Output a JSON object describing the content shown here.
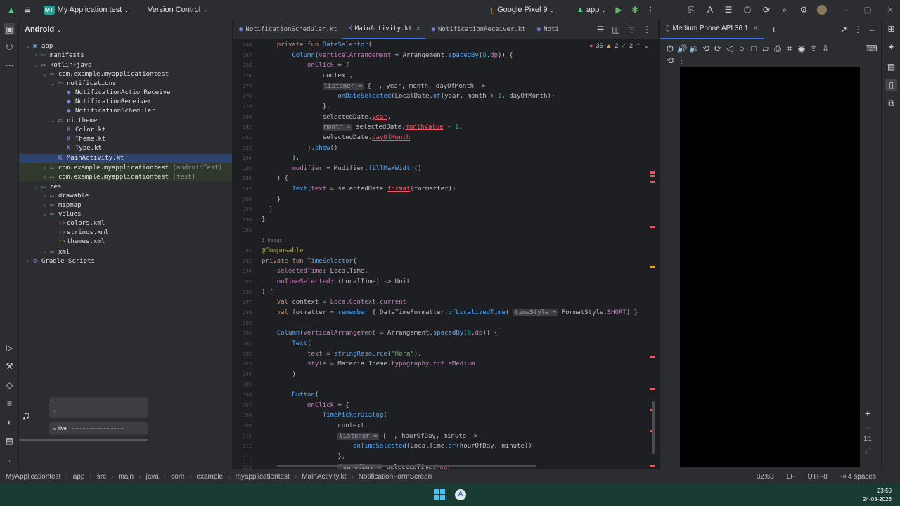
{
  "titlebar": {
    "logo": "MT",
    "project": "My Application test",
    "vcs": "Version Control",
    "device": "Google Pixel 9",
    "run_config": "app"
  },
  "project_panel": {
    "view": "Android",
    "tree": [
      {
        "label": "app",
        "depth": 0,
        "type": "module",
        "open": true
      },
      {
        "label": "manifests",
        "depth": 1,
        "type": "folder",
        "open": false
      },
      {
        "label": "kotlin+java",
        "depth": 1,
        "type": "folder",
        "open": true
      },
      {
        "label": "com.example.myapplicationtest",
        "depth": 2,
        "type": "package",
        "open": true
      },
      {
        "label": "notifications",
        "depth": 3,
        "type": "package",
        "open": true
      },
      {
        "label": "NotificationActionReceiver",
        "depth": 4,
        "type": "class"
      },
      {
        "label": "NotificationReceiver",
        "depth": 4,
        "type": "class"
      },
      {
        "label": "NotificationScheduler",
        "depth": 4,
        "type": "class"
      },
      {
        "label": "ui.theme",
        "depth": 3,
        "type": "package",
        "open": true
      },
      {
        "label": "Color.kt",
        "depth": 4,
        "type": "kt"
      },
      {
        "label": "Theme.kt",
        "depth": 4,
        "type": "kt"
      },
      {
        "label": "Type.kt",
        "depth": 4,
        "type": "kt"
      },
      {
        "label": "MainActivity.kt",
        "depth": 3,
        "type": "kt",
        "selected": true
      },
      {
        "label": "com.example.myapplicationtest (androidTest)",
        "depth": 2,
        "type": "package",
        "open": false
      },
      {
        "label": "com.example.myapplicationtest (test)",
        "depth": 2,
        "type": "package",
        "open": false
      },
      {
        "label": "res",
        "depth": 1,
        "type": "folder",
        "open": true
      },
      {
        "label": "drawable",
        "depth": 2,
        "type": "folder",
        "open": false
      },
      {
        "label": "mipmap",
        "depth": 2,
        "type": "folder",
        "open": false
      },
      {
        "label": "values",
        "depth": 2,
        "type": "folder",
        "open": true
      },
      {
        "label": "colors.xml",
        "depth": 3,
        "type": "xml"
      },
      {
        "label": "strings.xml",
        "depth": 3,
        "type": "xml"
      },
      {
        "label": "themes.xml",
        "depth": 3,
        "type": "xml"
      },
      {
        "label": "xml",
        "depth": 2,
        "type": "folder",
        "open": false
      },
      {
        "label": "Gradle Scripts",
        "depth": 0,
        "type": "gradle",
        "open": false
      }
    ]
  },
  "editor": {
    "tabs": [
      {
        "label": "NotificationScheduler.kt",
        "active": false
      },
      {
        "label": "MainActivity.kt",
        "active": true
      },
      {
        "label": "NotificationReceiver.kt",
        "active": false
      },
      {
        "label": "Noti",
        "active": false
      }
    ],
    "inspections": {
      "errors": "35",
      "warnings": "2",
      "weak": "2"
    },
    "lines": [
      {
        "n": "268",
        "h": "    <span class=kw>private fun</span> <span class=fn>DateSelector</span>("
      },
      {
        "n": "267",
        "h": "        <span class=fn>Column</span>(<span class=ty>verticalArrangement</span> = Arrangement.<span class=fn>spacedBy</span>(<span class=num>8</span>.<span class=ty>dp</span>)) {"
      },
      {
        "n": "268",
        "h": "            <span class=ty>onClick</span> = {"
      },
      {
        "n": "276",
        "h": "                context,"
      },
      {
        "n": "277",
        "h": "                <span class=hint>listener =</span> { _, year, month, dayOfMonth -&gt;"
      },
      {
        "n": "278",
        "h": "                    <span class=fn>onDateSelected</span>(LocalDate.<span class=fn>of</span>(year, month + <span class=num>1</span>, dayOfMonth))"
      },
      {
        "n": "279",
        "h": "                },"
      },
      {
        "n": "280",
        "h": "                selectedDate.<span class=err>year</span>,"
      },
      {
        "n": "281",
        "h": "                <span class=hint>month =</span> selectedDate.<span class=err>monthValue</span> - <span class=num>1</span>,"
      },
      {
        "n": "282",
        "h": "                selectedDate.<span class=err>dayOfMonth</span>"
      },
      {
        "n": "283",
        "h": "            ).<span class=fn>show</span>()"
      },
      {
        "n": "284",
        "h": "        },"
      },
      {
        "n": "285",
        "h": "        <span class=ty>modifier</span> = Modifier.<span class=fn>fillMaxWidth</span>()"
      },
      {
        "n": "286",
        "h": "    ) {"
      },
      {
        "n": "287",
        "h": "        <span class=fn>Text</span>(<span class=ty>text</span> = selectedDate.<span class=err>format</span>(formatter))"
      },
      {
        "n": "288",
        "h": "    }"
      },
      {
        "n": "289",
        "h": "  }"
      },
      {
        "n": "290",
        "h": "}"
      },
      {
        "n": "291",
        "h": ""
      },
      {
        "n": "",
        "h": "<span style='color:#6f737a;font-size:7px'>1 Usage</span>"
      },
      {
        "n": "292",
        "h": "<span class=ann>@Composable</span>"
      },
      {
        "n": "293",
        "h": "<span class=kw>private fun</span> <span class=fn>TimeSelector</span>("
      },
      {
        "n": "294",
        "h": "    <span class=ty>selectedTime</span>: LocalTime,"
      },
      {
        "n": "295",
        "h": "    <span class=ty>onTimeSelected</span>: (LocalTime) -&gt; Unit"
      },
      {
        "n": "296",
        "h": ") {"
      },
      {
        "n": "297",
        "h": "    <span class=kw>val</span> context = <span class=ty>LocalContext</span>.<span class=ty>current</span>"
      },
      {
        "n": "298",
        "h": "    <span class=kw>val</span> formatter = <span class=fn>remember</span> { DateTimeFormatter.<span class=fn>ofLocalizedTime</span>( <span class=hint>timeStyle =</span> FormatStyle.<span class=ty>SHORT</span>) }"
      },
      {
        "n": "299",
        "h": ""
      },
      {
        "n": "300",
        "h": "    <span class=fn>Column</span>(<span class=ty>verticalArrangement</span> = Arrangement.<span class=fn>spacedBy</span>(<span class=num>8</span>.<span class=ty>dp</span>)) {"
      },
      {
        "n": "301",
        "h": "        <span class=fn>Text</span>("
      },
      {
        "n": "302",
        "h": "            <span class=ty>text</span> = <span class=fn>stringResource</span>(<span class=str>\"Hora\"</span>),"
      },
      {
        "n": "303",
        "h": "            <span class=ty>style</span> = MaterialTheme.<span class=ty>typography</span>.<span class=ty>titleMedium</span>"
      },
      {
        "n": "304",
        "h": "        )"
      },
      {
        "n": "305",
        "h": ""
      },
      {
        "n": "306",
        "h": "        <span class=fn>Button</span>("
      },
      {
        "n": "307",
        "h": "            <span class=ty>onClick</span> = {"
      },
      {
        "n": "308",
        "h": "                <span class=fn>TimePickerDialog</span>("
      },
      {
        "n": "309",
        "h": "                    context,"
      },
      {
        "n": "310",
        "h": "                    <span class=hint>listener =</span> { _, hourOfDay, minute -&gt;"
      },
      {
        "n": "311",
        "h": "                        <span class=fn>onTimeSelected</span>(LocalTime.<span class=fn>of</span>(hourOfDay, minute))"
      },
      {
        "n": "312",
        "h": "                    },"
      },
      {
        "n": "313",
        "h": "                    <span class=hint>hourOfDay =</span> selectedTime.<span class=err>hour</span>"
      }
    ]
  },
  "emulator": {
    "tab": "Medium Phone API 36.1",
    "zoom_ratio": "1:1"
  },
  "media": {
    "live": "live"
  },
  "statusbar": {
    "breadcrumbs": [
      "MyApplicationtest",
      "app",
      "src",
      "main",
      "java",
      "com",
      "example",
      "myapplicationtest",
      "MainActivity.kt",
      "NotificationFormScreen"
    ],
    "position": "82:63",
    "line_sep": "LF",
    "encoding": "UTF-8",
    "indent": "4 spaces"
  },
  "taskbar": {
    "time": "23:50",
    "date": "24-03-2026"
  },
  "colors": {
    "accent": "#3574f0",
    "error": "#db5c5c",
    "warning": "#e0a33c"
  }
}
